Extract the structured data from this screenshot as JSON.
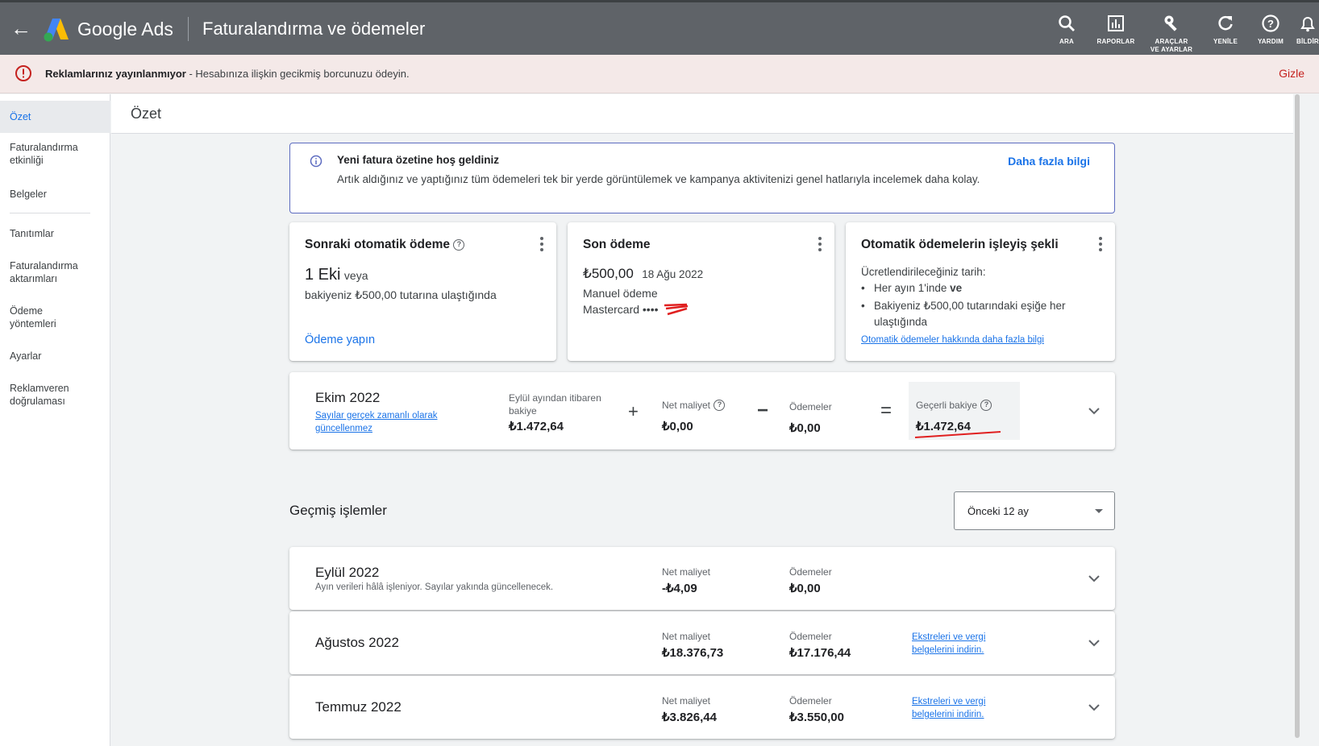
{
  "header": {
    "brand": "Google Ads",
    "page_title": "Faturalandırma ve ödemeler",
    "tools": [
      {
        "label": "ARA",
        "icon": "search-icon"
      },
      {
        "label": "RAPORLAR",
        "icon": "reports-icon"
      },
      {
        "label_line1": "ARAÇLAR",
        "label_line2": "VE AYARLAR",
        "icon": "wrench-icon"
      },
      {
        "label": "YENİLE",
        "icon": "refresh-icon"
      },
      {
        "label": "YARDIM",
        "icon": "help-icon"
      },
      {
        "label": "BİLDİRİ",
        "icon": "bell-icon"
      }
    ]
  },
  "alert": {
    "bold": "Reklamlarınız yayınlanmıyor",
    "text": " - Hesabınıza ilişkin gecikmiş borcunuzu ödeyin.",
    "hide": "Gizle",
    "color": "#c5221f"
  },
  "sidebar": {
    "items": [
      {
        "label": "Özet"
      },
      {
        "label_line1": "Faturalandırma",
        "label_line2": "etkinliği"
      },
      {
        "label": "Belgeler"
      },
      {
        "label": "Tanıtımlar"
      },
      {
        "label_line1": "Faturalandırma",
        "label_line2": "aktarımları"
      },
      {
        "label_line1": "Ödeme",
        "label_line2": "yöntemleri"
      },
      {
        "label": "Ayarlar"
      },
      {
        "label_line1": "Reklamveren",
        "label_line2": "doğrulaması"
      }
    ]
  },
  "main": {
    "title": "Özet"
  },
  "info": {
    "title": "Yeni fatura özetine hoş geldiniz",
    "body": "Artık aldığınız ve yaptığınız tüm ödemeleri tek bir yerde görüntülemek ve kampanya aktivitenizi genel hatlarıyla incelemek daha kolay.",
    "more": "Daha fazla bilgi"
  },
  "next_payment": {
    "title": "Sonraki otomatik ödeme",
    "date": "1 Eki",
    "or": "veya",
    "threshold": "bakiyeniz ₺500,00 tutarına ulaştığında",
    "action": "Ödeme yapın"
  },
  "last_payment": {
    "title": "Son ödeme",
    "amount": "₺500,00",
    "date": "18 Ağu 2022",
    "method": "Manuel ödeme",
    "card": "Mastercard ••••"
  },
  "how_it_works": {
    "title": "Otomatik ödemelerin işleyiş şekli",
    "intro": "Ücretlendirileceğiniz tarih:",
    "bullet1": "Her ayın 1'inde",
    "bullet1_bold": "ve",
    "bullet2_line1": "Bakiyeniz ₺500,00 tutarındaki eşiğe her",
    "bullet2_line2": "ulaştığında",
    "link": "Otomatik ödemeler hakkında daha fazla bilgi"
  },
  "current": {
    "month": "Ekim 2022",
    "note_line1": "Sayılar gerçek zamanlı olarak",
    "note_line2": "güncellenmez",
    "carry_label_line1": "Eylül ayından itibaren",
    "carry_label_line2": "bakiye",
    "carry_value": "₺1.472,64",
    "plus": "+",
    "net_label": "Net maliyet",
    "net_value": "₺0,00",
    "minus": "−",
    "pay_label": "Ödemeler",
    "pay_value": "₺0,00",
    "equals": "=",
    "balance_label": "Geçerli bakiye",
    "balance_value": "₺1.472,64"
  },
  "history": {
    "title": "Geçmiş işlemler",
    "range": "Önceki 12 ay",
    "rows": [
      {
        "month": "Eylül 2022",
        "sub": "Ayın verileri hâlâ işleniyor. Sayılar yakında güncellenecek.",
        "net_label": "Net maliyet",
        "net": "-₺4,09",
        "pay_label": "Ödemeler",
        "pay": "₺0,00",
        "link1": "",
        "link2": ""
      },
      {
        "month": "Ağustos 2022",
        "sub": "",
        "net_label": "Net maliyet",
        "net": "₺18.376,73",
        "pay_label": "Ödemeler",
        "pay": "₺17.176,44",
        "link1": "Ekstreleri ve vergi",
        "link2": "belgelerini indirin."
      },
      {
        "month": "Temmuz 2022",
        "sub": "",
        "net_label": "Net maliyet",
        "net": "₺3.826,44",
        "pay_label": "Ödemeler",
        "pay": "₺3.550,00",
        "link1": "Ekstreleri ve vergi",
        "link2": "belgelerini indirin."
      }
    ]
  }
}
